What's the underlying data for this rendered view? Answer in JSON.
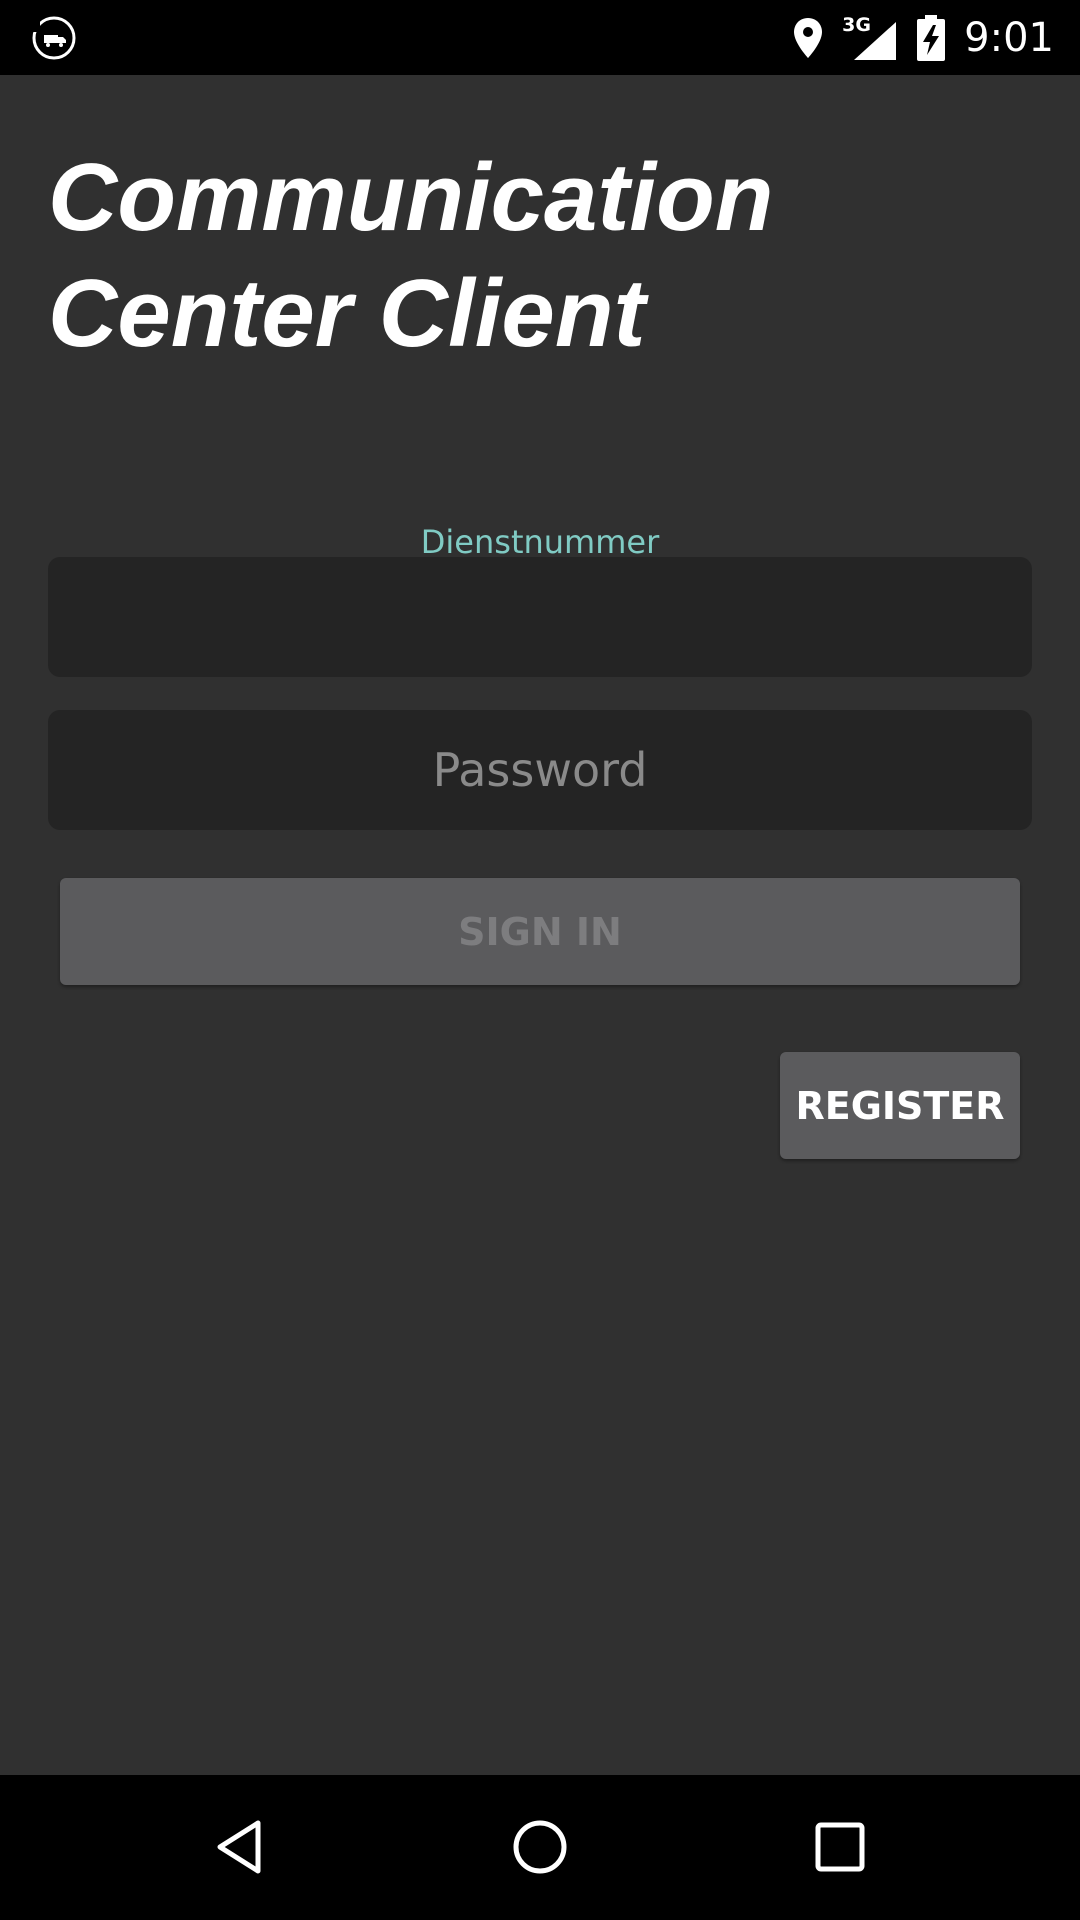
{
  "status_bar": {
    "time": "9:01",
    "network_type": "3G",
    "icons": [
      "app-notification-icon",
      "location-icon",
      "signal-icon",
      "battery-charging-icon"
    ]
  },
  "app": {
    "title_line1": "Communication",
    "title_line2": "Center Client"
  },
  "form": {
    "service_number_label": "Dienstnummer",
    "service_number_value": "",
    "password_placeholder": "Password",
    "password_value": "",
    "sign_in_label": "SIGN IN",
    "register_label": "REGISTER"
  },
  "nav_bar": {
    "icons": [
      "back-icon",
      "home-icon",
      "recents-icon"
    ]
  },
  "colors": {
    "background": "#303030",
    "field_background": "#242424",
    "accent_label": "#80cbc4",
    "button_background": "#5b5b5d",
    "disabled_text": "#7d7d7f"
  }
}
